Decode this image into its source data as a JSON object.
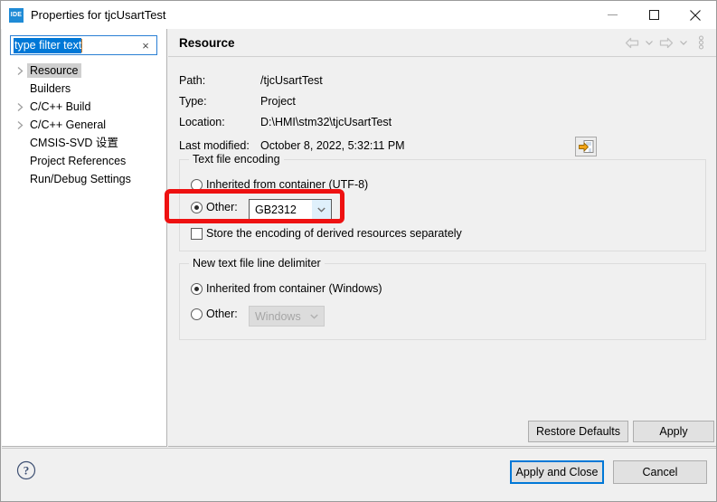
{
  "window": {
    "title": "Properties for tjcUsartTest",
    "app_icon": "IDE",
    "controls": {
      "minimize": "minimize-icon",
      "maximize": "maximize-icon",
      "close": "close-icon"
    }
  },
  "sidebar": {
    "filter": {
      "value": "type filter text",
      "placeholder": "type filter text",
      "clear_label": "×"
    },
    "items": [
      {
        "label": "Resource",
        "expandable": true,
        "selected": true
      },
      {
        "label": "Builders",
        "expandable": false,
        "selected": false
      },
      {
        "label": "C/C++ Build",
        "expandable": true,
        "selected": false
      },
      {
        "label": "C/C++ General",
        "expandable": true,
        "selected": false
      },
      {
        "label": "CMSIS-SVD 设置",
        "expandable": false,
        "selected": false
      },
      {
        "label": "Project References",
        "expandable": false,
        "selected": false
      },
      {
        "label": "Run/Debug Settings",
        "expandable": false,
        "selected": false
      }
    ]
  },
  "page": {
    "title": "Resource",
    "nav": {
      "back": "back-arrow-icon",
      "back_menu": "chevron-down-icon",
      "forward": "forward-arrow-icon",
      "forward_menu": "chevron-down-icon",
      "view_menu": "view-menu-icon"
    },
    "info": [
      {
        "label": "Path:",
        "value": "/tjcUsartTest"
      },
      {
        "label": "Type:",
        "value": "Project"
      },
      {
        "label": "Location:",
        "value": "D:\\HMI\\stm32\\tjcUsartTest"
      },
      {
        "label": "Last modified:",
        "value": "October 8, 2022, 5:32:11 PM"
      }
    ],
    "browse_button": "edit-location-icon",
    "encoding_group": {
      "legend": "Text file encoding",
      "inherited_label": "Inherited from container (UTF-8)",
      "inherited_selected": false,
      "other_label": "Other:",
      "other_selected": true,
      "other_value": "GB2312",
      "store_derived_label": "Store the encoding of derived resources separately",
      "store_derived_checked": false
    },
    "delimiter_group": {
      "legend": "New text file line delimiter",
      "inherited_label": "Inherited from container (Windows)",
      "inherited_selected": true,
      "other_label": "Other:",
      "other_selected": false,
      "other_value": "Windows",
      "other_disabled": true
    },
    "restore_defaults_label": "Restore Defaults",
    "apply_label": "Apply"
  },
  "footer": {
    "help_icon": "help-icon",
    "apply_and_close_label": "Apply and Close",
    "cancel_label": "Cancel"
  },
  "colors": {
    "accent": "#0078d7",
    "selection": "#0078d7",
    "highlight_box": "#ee1111",
    "window_bg": "#f0f0f0",
    "panel_bg": "#ffffff"
  }
}
